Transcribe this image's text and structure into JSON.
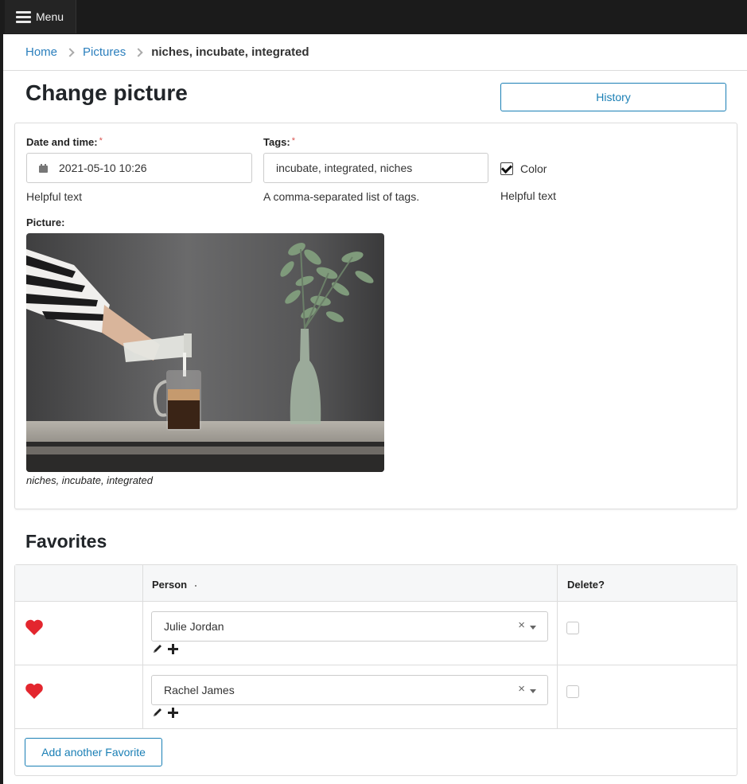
{
  "topbar": {
    "menu_label": "Menu",
    "menu_icon": "hamburger-icon"
  },
  "breadcrumb": {
    "home": "Home",
    "section": "Pictures",
    "current": "niches, incubate, integrated"
  },
  "page": {
    "title": "Change picture",
    "history_label": "History"
  },
  "form": {
    "date": {
      "label": "Date and time:",
      "value": "2021-05-10 10:26",
      "help": "Helpful text",
      "icon": "calendar-icon"
    },
    "tags": {
      "label": "Tags:",
      "value": "incubate, integrated, niches",
      "help": "A comma-separated list of tags."
    },
    "color": {
      "label": "Color",
      "checked": true,
      "help": "Helpful text"
    },
    "picture": {
      "label": "Picture:",
      "caption": "niches, incubate, integrated"
    }
  },
  "favorites": {
    "title": "Favorites",
    "columns": {
      "person": "Person",
      "delete": "Delete?"
    },
    "rows": [
      {
        "person": "Julie Jordan",
        "delete": false
      },
      {
        "person": "Rachel James",
        "delete": false
      }
    ],
    "add_label": "Add another Favorite",
    "clear_glyph": "×"
  },
  "colors": {
    "accent": "#1a7fb5",
    "link": "#2b7fbd",
    "heart": "#e3262e",
    "topbar": "#1b1b1b",
    "required": "#d9534f"
  }
}
